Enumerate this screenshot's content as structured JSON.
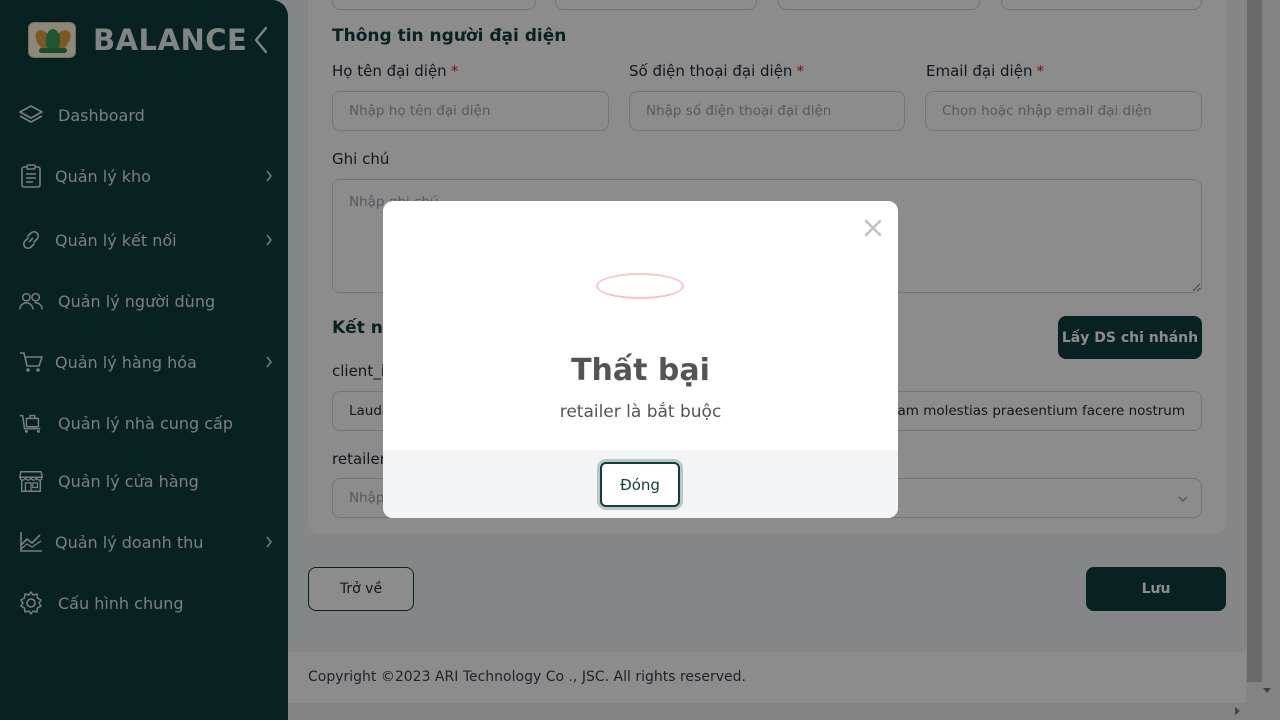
{
  "sidebar": {
    "brand": "BALANCE",
    "items": [
      {
        "label": "Dashboard",
        "icon": "layers-icon"
      },
      {
        "label": "Quản lý kho",
        "icon": "clipboard-icon"
      },
      {
        "label": "Quản lý kết nối",
        "icon": "link-icon"
      },
      {
        "label": "Quản lý người dùng",
        "icon": "users-icon"
      },
      {
        "label": "Quản lý hàng hóa",
        "icon": "cart-icon"
      },
      {
        "label": "Quản lý nhà cung cấp",
        "icon": "supplier-icon"
      },
      {
        "label": "Quản lý cửa hàng",
        "icon": "store-icon"
      },
      {
        "label": "Quản lý doanh thu",
        "icon": "revenue-chart-icon"
      },
      {
        "label": "Cấu hình chung",
        "icon": "gear-icon"
      }
    ]
  },
  "form": {
    "rep_section_title": "Thông tin người đại diện",
    "rep_name_label": "Họ tên đại diện",
    "rep_name_placeholder": "Nhập họ tên đại diện",
    "rep_phone_label": "Số điện thoại đại diện",
    "rep_phone_placeholder": "Nhập số điện thoại đại diện",
    "rep_email_label": "Email đại diện",
    "rep_email_placeholder": "Chọn hoặc nhập email đại diện",
    "required_mark": "*",
    "note_label": "Ghi chú",
    "note_placeholder": "Nhập ghi chú",
    "connect_section_title": "Kết nối",
    "fetch_branches_label": "Lấy DS chi nhánh",
    "client_label": "client_id",
    "client_value": "Laudantium",
    "client_secret_value": "am molestias praesentium facere nostrum",
    "retailer_label": "retailer",
    "retailer_placeholder": "Nhập retailer",
    "back_label": "Trở về",
    "save_label": "Lưu"
  },
  "footer": {
    "copyright": "Copyright ©2023 ARI Technology Co ., JSC. All rights reserved."
  },
  "modal": {
    "title": "Thất bại",
    "message": "retailer là bắt buộc",
    "close_button": "Đóng"
  },
  "colors": {
    "brand_dark": "#103f3d",
    "required": "#dc2626",
    "error_ring": "#f6c6c6"
  }
}
